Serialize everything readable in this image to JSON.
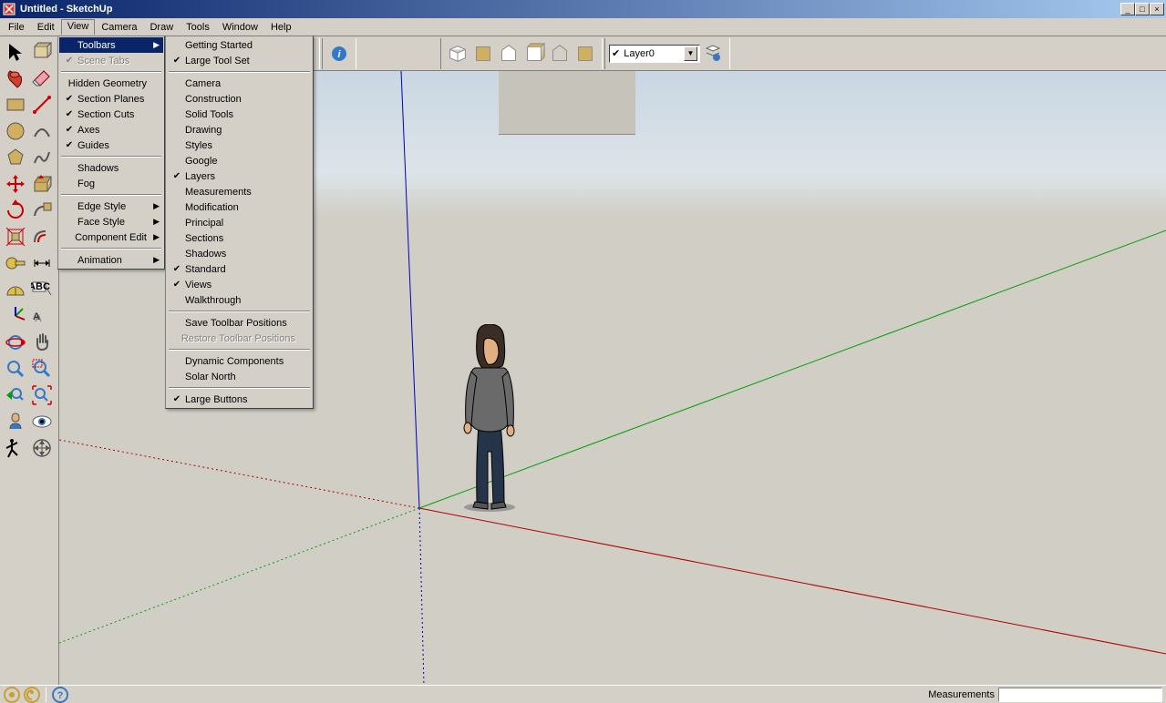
{
  "window": {
    "title": "Untitled - SketchUp",
    "min_label": "_",
    "max_label": "□",
    "close_label": "×"
  },
  "menubar": {
    "items": [
      "File",
      "Edit",
      "View",
      "Camera",
      "Draw",
      "Tools",
      "Window",
      "Help"
    ],
    "active_index": 2
  },
  "view_menu": {
    "items": [
      {
        "label": "Toolbars",
        "checked": false,
        "submenu": true,
        "highlighted": true
      },
      {
        "label": "Scene Tabs",
        "checked": true,
        "disabled": true
      },
      {
        "sep": true
      },
      {
        "label": "Hidden Geometry",
        "checked": false
      },
      {
        "label": "Section Planes",
        "checked": true
      },
      {
        "label": "Section Cuts",
        "checked": true
      },
      {
        "label": "Axes",
        "checked": true
      },
      {
        "label": "Guides",
        "checked": true
      },
      {
        "sep": true
      },
      {
        "label": "Shadows",
        "checked": false
      },
      {
        "label": "Fog",
        "checked": false
      },
      {
        "sep": true
      },
      {
        "label": "Edge Style",
        "checked": false,
        "submenu": true
      },
      {
        "label": "Face Style",
        "checked": false,
        "submenu": true
      },
      {
        "label": "Component Edit",
        "checked": false,
        "submenu": true
      },
      {
        "sep": true
      },
      {
        "label": "Animation",
        "checked": false,
        "submenu": true
      }
    ]
  },
  "toolbars_menu": {
    "items": [
      {
        "label": "Getting Started",
        "checked": false
      },
      {
        "label": "Large Tool Set",
        "checked": true
      },
      {
        "sep": true
      },
      {
        "label": "Camera",
        "checked": false
      },
      {
        "label": "Construction",
        "checked": false
      },
      {
        "label": "Solid Tools",
        "checked": false
      },
      {
        "label": "Drawing",
        "checked": false
      },
      {
        "label": "Styles",
        "checked": false
      },
      {
        "label": "Google",
        "checked": false
      },
      {
        "label": "Layers",
        "checked": true
      },
      {
        "label": "Measurements",
        "checked": false
      },
      {
        "label": "Modification",
        "checked": false
      },
      {
        "label": "Principal",
        "checked": false
      },
      {
        "label": "Sections",
        "checked": false
      },
      {
        "label": "Shadows",
        "checked": false
      },
      {
        "label": "Standard",
        "checked": true
      },
      {
        "label": "Views",
        "checked": true
      },
      {
        "label": "Walkthrough",
        "checked": false
      },
      {
        "sep": true
      },
      {
        "label": "Save Toolbar Positions",
        "checked": false
      },
      {
        "label": "Restore Toolbar Positions",
        "checked": false,
        "disabled": true
      },
      {
        "sep": true
      },
      {
        "label": "Dynamic Components",
        "checked": false
      },
      {
        "label": "Solar North",
        "checked": false
      },
      {
        "sep": true
      },
      {
        "label": "Large Buttons",
        "checked": true
      }
    ]
  },
  "top_toolbar": {
    "layer_selected": "Layer0"
  },
  "statusbar": {
    "measurements_label": "Measurements"
  },
  "left_tools": [
    [
      "select",
      "component"
    ],
    [
      "paint",
      "eraser"
    ],
    [
      "rectangle",
      "line"
    ],
    [
      "circle",
      "arc"
    ],
    [
      "polygon",
      "freehand"
    ],
    [
      "move",
      "pushpull"
    ],
    [
      "rotate",
      "followme"
    ],
    [
      "scale",
      "offset"
    ],
    [
      "tape",
      "dimension"
    ],
    [
      "protractor",
      "text"
    ],
    [
      "axes",
      "3dtext"
    ],
    [
      "orbit",
      "pan"
    ],
    [
      "zoom",
      "zoomwindow"
    ],
    [
      "previous",
      "zoomextents"
    ],
    [
      "position-camera",
      "lookaround"
    ],
    [
      "walk",
      "section"
    ]
  ],
  "top_tools_views": [
    "iso",
    "top",
    "front",
    "right",
    "back",
    "left"
  ],
  "colors": {
    "accent": "#0a246a",
    "axis_red": "#b00000",
    "axis_green": "#00a000",
    "axis_blue": "#0000c0"
  }
}
